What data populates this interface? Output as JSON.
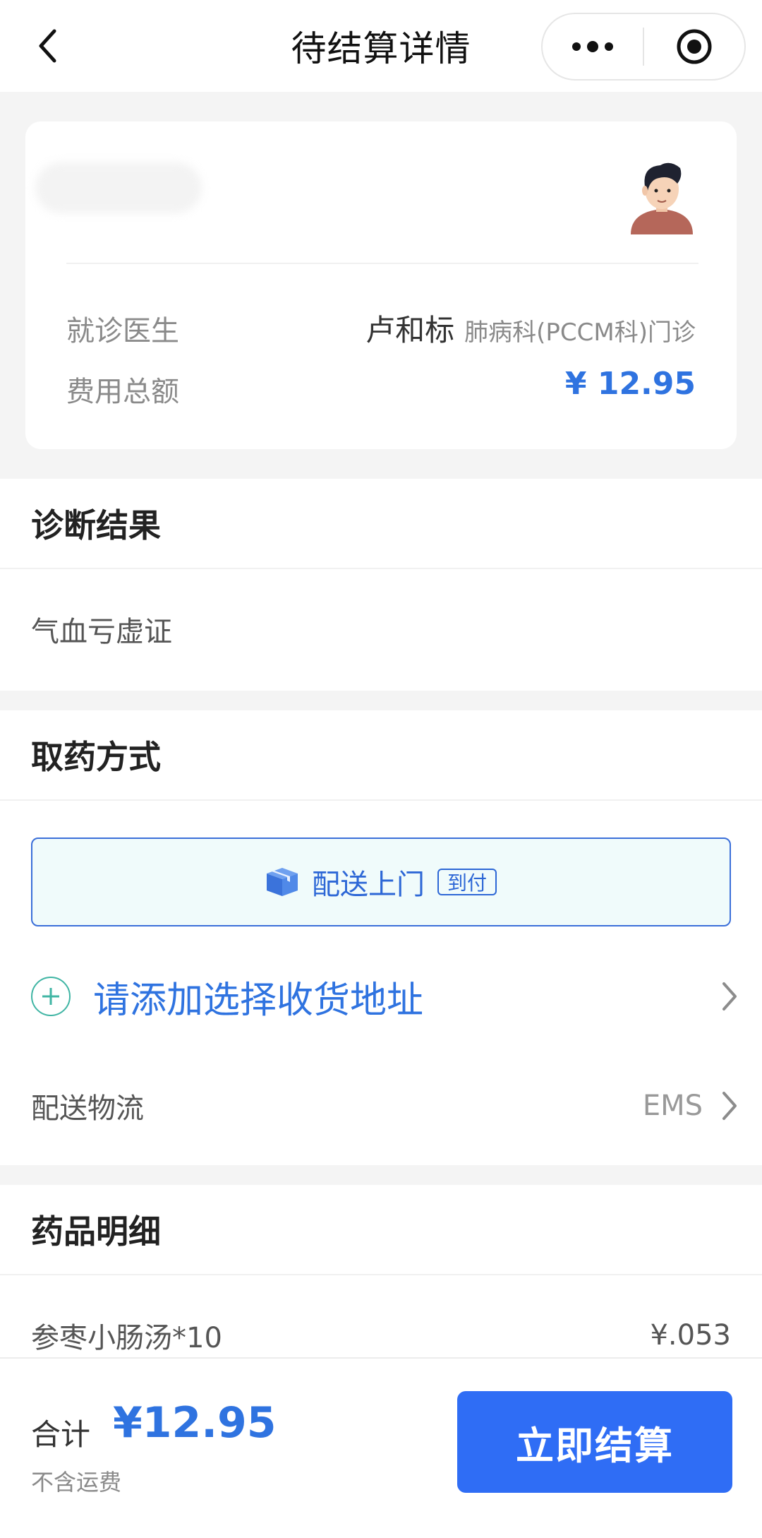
{
  "nav": {
    "title": "待结算详情"
  },
  "patient_card": {
    "doctor_label": "就诊医生",
    "doctor_name": "卢和标",
    "doctor_dept": "肺病科(PCCM科)门诊",
    "amount_label": "费用总额",
    "amount_value": "¥ 12.95"
  },
  "diagnosis": {
    "title": "诊断结果",
    "result": "气血亏虚证"
  },
  "pickup": {
    "title": "取药方式",
    "delivery_label": "配送上门",
    "delivery_tag": "到付",
    "address_prompt": "请添加选择收货地址",
    "logistics_label": "配送物流",
    "logistics_value": "EMS"
  },
  "medicines": {
    "title": "药品明细",
    "items": [
      {
        "name": "参枣小肠汤*10",
        "price": "¥.053"
      }
    ]
  },
  "footer": {
    "total_label": "合计",
    "total_value": "¥12.95",
    "shipping_note": "不含运费",
    "pay_button": "立即结算"
  },
  "colors": {
    "accent": "#2f73e0",
    "button": "#2f6df5",
    "plus": "#40b5a4"
  }
}
